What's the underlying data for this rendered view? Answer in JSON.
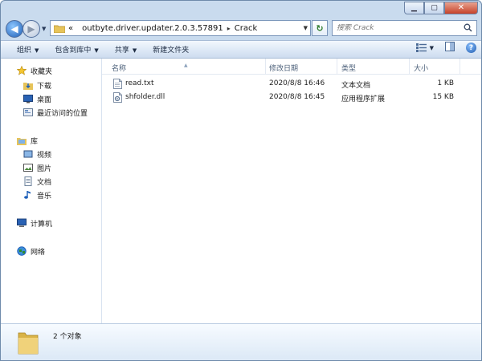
{
  "address": {
    "overflow": "«",
    "crumbs": [
      "outbyte.driver.updater.2.0.3.57891",
      "Crack"
    ],
    "separator": "▸"
  },
  "search": {
    "placeholder": "搜索 Crack"
  },
  "toolbar": {
    "organize": "组织",
    "include_in_library": "包含到库中",
    "share": "共享",
    "new_folder": "新建文件夹"
  },
  "sidebar": {
    "favorites": {
      "label": "收藏夹",
      "items": [
        "下载",
        "桌面",
        "最近访问的位置"
      ]
    },
    "libraries": {
      "label": "库",
      "items": [
        "视频",
        "图片",
        "文档",
        "音乐"
      ]
    },
    "computer": "计算机",
    "network": "网络"
  },
  "columns": {
    "name": "名称",
    "modified": "修改日期",
    "type": "类型",
    "size": "大小"
  },
  "files": [
    {
      "name": "read.txt",
      "modified": "2020/8/8 16:46",
      "type": "文本文档",
      "size": "1 KB",
      "icon": "text-file-icon"
    },
    {
      "name": "shfolder.dll",
      "modified": "2020/8/8 16:45",
      "type": "应用程序扩展",
      "size": "15 KB",
      "icon": "dll-file-icon"
    }
  ],
  "status": {
    "count": "2 个对象"
  },
  "colors": {
    "frame": "#c9dbee",
    "accent": "#1f5fb6",
    "close": "#c6432a"
  }
}
